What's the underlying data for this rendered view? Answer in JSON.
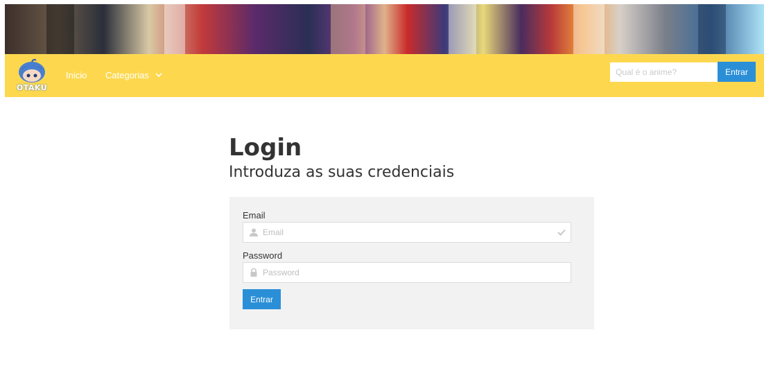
{
  "header": {
    "logo_text": "OTAKU",
    "nav": {
      "home": "Inicio",
      "categories": "Categorias"
    },
    "search": {
      "placeholder": "Qual é o anime?",
      "button": "Entrar"
    }
  },
  "main": {
    "title": "Login",
    "subtitle": "Introduza as suas credenciais",
    "form": {
      "email_label": "Email",
      "email_placeholder": "Email",
      "password_label": "Password",
      "password_placeholder": "Password",
      "submit": "Entrar"
    }
  },
  "colors": {
    "navbar": "#fdd84f",
    "button": "#2b8fd8",
    "panel": "#f2f2f2"
  },
  "icons": [
    "chevron-down-icon",
    "user-icon",
    "lock-icon",
    "check-icon"
  ]
}
